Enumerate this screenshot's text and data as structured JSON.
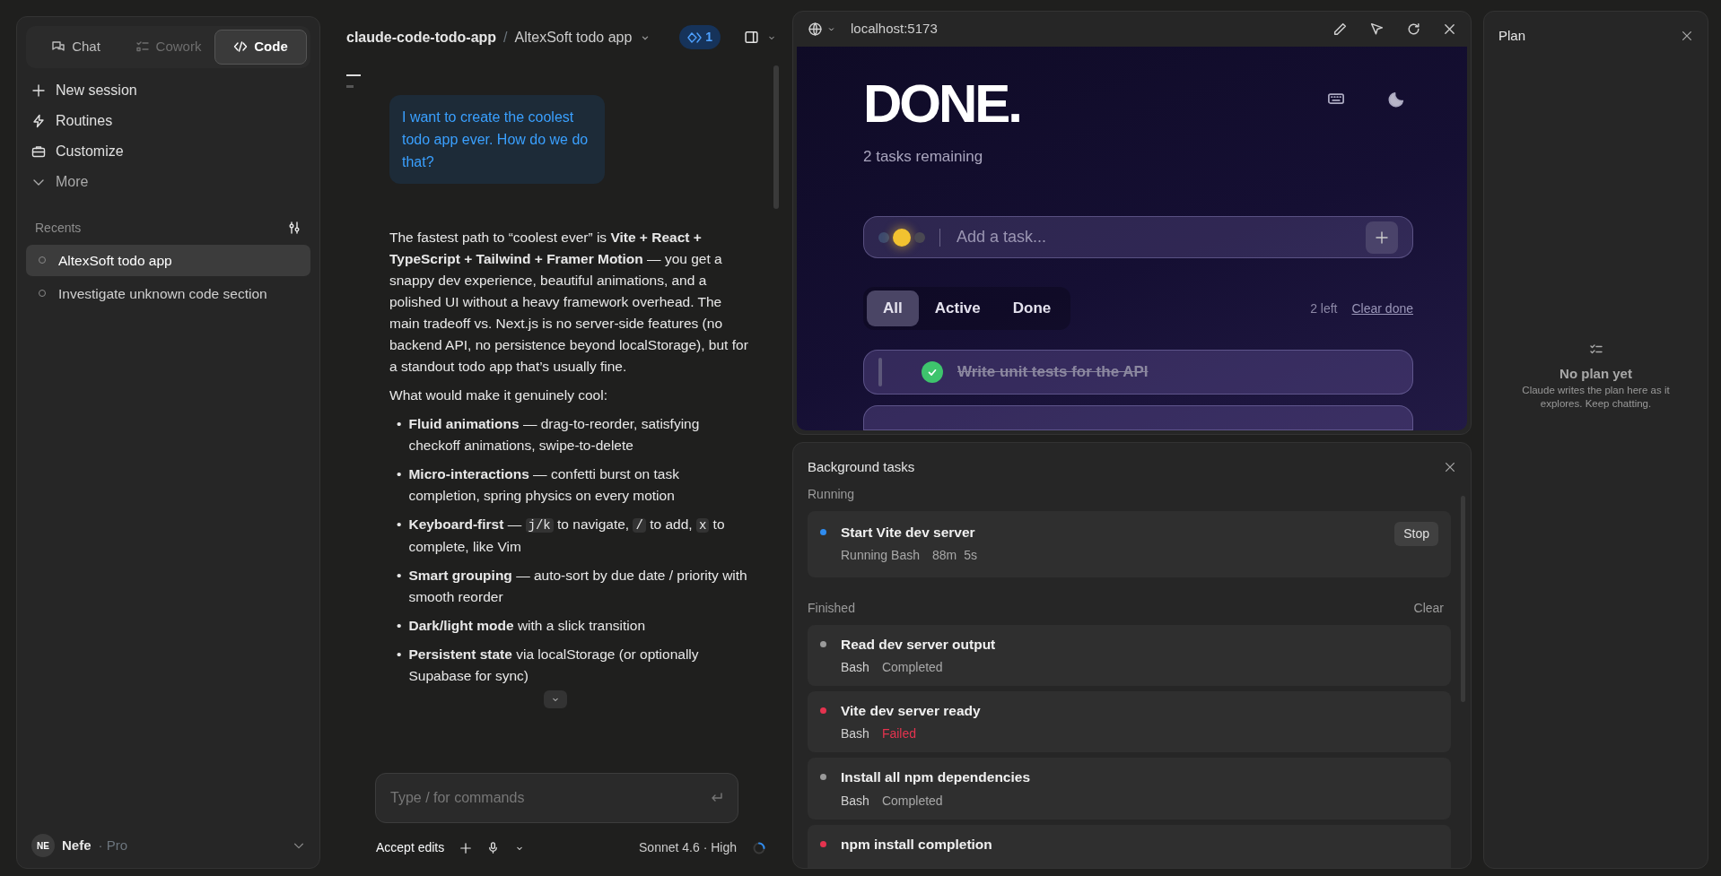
{
  "sidebar": {
    "modes": [
      {
        "label": "Chat",
        "kind": "chat",
        "selected": false,
        "disabled": false
      },
      {
        "label": "Cowork",
        "kind": "cowork",
        "selected": false,
        "disabled": true
      },
      {
        "label": "Code",
        "kind": "code",
        "selected": true,
        "disabled": false
      }
    ],
    "nav": [
      {
        "label": "New session",
        "kind": "plus"
      },
      {
        "label": "Routines",
        "kind": "bolt"
      },
      {
        "label": "Customize",
        "kind": "briefcase"
      },
      {
        "label": "More",
        "kind": "chevron"
      }
    ],
    "recents_title": "Recents",
    "recents": [
      {
        "label": "AltexSoft todo app",
        "selected": true
      },
      {
        "label": "Investigate unknown code section",
        "selected": false
      }
    ],
    "user": {
      "initials": "NE",
      "name": "Nefe",
      "plan": "· Pro"
    }
  },
  "chat": {
    "project": "claude-code-todo-app",
    "separator": "/",
    "session": "AltexSoft todo app",
    "badge": "1",
    "user_message": "I want to create the coolest todo app ever. How do we do that?",
    "response": "The fastest path to “coolest ever” is **Vite + React + TypeScript + Tailwind + Framer Motion** — you get a snappy dev experience, beautiful animations, and a polished UI without a heavy framework overhead. The main tradeoff vs. Next.js is no server-side features (no backend API, no persistence beyond localStorage), but for a standout todo app that’s usually fine.",
    "lead_in": "What would make it genuinely cool:",
    "bullets": [
      {
        "marker": "•",
        "segments": [
          {
            "kind": "bold",
            "text": "Fluid animations"
          },
          {
            "kind": "text",
            "text": " — drag-to-reorder, satisfying checkoff animations, swipe-to-delete"
          }
        ]
      },
      {
        "marker": "•",
        "segments": [
          {
            "kind": "bold",
            "text": "Micro-interactions"
          },
          {
            "kind": "text",
            "text": " — confetti burst on task completion, spring physics on every motion"
          }
        ]
      },
      {
        "marker": "•",
        "segments": [
          {
            "kind": "bold",
            "text": "Keyboard-first"
          },
          {
            "kind": "text",
            "text": " — "
          },
          {
            "kind": "code",
            "text": "j/k"
          },
          {
            "kind": "text",
            "text": " to navigate, "
          },
          {
            "kind": "code",
            "text": "/"
          },
          {
            "kind": "text",
            "text": " to add, "
          },
          {
            "kind": "code",
            "text": "x"
          },
          {
            "kind": "text",
            "text": " to complete, like Vim"
          }
        ]
      },
      {
        "marker": "•",
        "segments": [
          {
            "kind": "bold",
            "text": "Smart grouping"
          },
          {
            "kind": "text",
            "text": " — auto-sort by due date / priority with smooth reorder"
          }
        ]
      },
      {
        "marker": "•",
        "segments": [
          {
            "kind": "bold",
            "text": "Dark/light mode"
          },
          {
            "kind": "text",
            "text": " with a slick transition"
          }
        ]
      },
      {
        "marker": "•",
        "segments": [
          {
            "kind": "bold",
            "text": "Persistent state"
          },
          {
            "kind": "text",
            "text": " via localStorage (or optionally Supabase for sync)"
          }
        ]
      }
    ],
    "composer": {
      "placeholder": "Type / for commands"
    },
    "footer": {
      "mode": "Accept edits",
      "model": "Sonnet 4.6 · High"
    }
  },
  "preview": {
    "url": "localhost:5173",
    "app": {
      "title": "DONE.",
      "subtitle": "2 tasks remaining",
      "input_placeholder": "Add a task...",
      "priorities": [
        {
          "color": "#3d4a6e",
          "selected": false
        },
        {
          "color": "#f2c230",
          "selected": true
        },
        {
          "color": "#4a4852",
          "selected": false
        }
      ],
      "filters": [
        {
          "label": "All",
          "selected": true
        },
        {
          "label": "Active",
          "selected": false
        },
        {
          "label": "Done",
          "selected": false
        }
      ],
      "left": "2 left",
      "clear": "Clear done",
      "tasks": [
        {
          "text": "Write unit tests for the API",
          "done": true
        }
      ]
    }
  },
  "background_tasks": {
    "title": "Background tasks",
    "running_label": "Running",
    "running": [
      {
        "title": "Start Vite dev server",
        "tool": "Running Bash",
        "elapsed": [
          "88m",
          "5s"
        ],
        "color": "#2f8cf0",
        "action": "Stop"
      }
    ],
    "finished_label": "Finished",
    "clear": "Clear",
    "finished": [
      {
        "title": "Read dev server output",
        "tool": "Bash",
        "status": "Completed",
        "kind": "completed",
        "color": "#9a9a9a"
      },
      {
        "title": "Vite dev server ready",
        "tool": "Bash",
        "status": "Failed",
        "kind": "failed",
        "color": "#e5334f"
      },
      {
        "title": "Install all npm dependencies",
        "tool": "Bash",
        "status": "Completed",
        "kind": "completed",
        "color": "#9a9a9a"
      },
      {
        "title": "npm install completion",
        "color": "#e5334f"
      }
    ]
  },
  "plan": {
    "title": "Plan",
    "empty_title": "No plan yet",
    "empty_text": "Claude writes the plan here as it explores. Keep chatting."
  }
}
